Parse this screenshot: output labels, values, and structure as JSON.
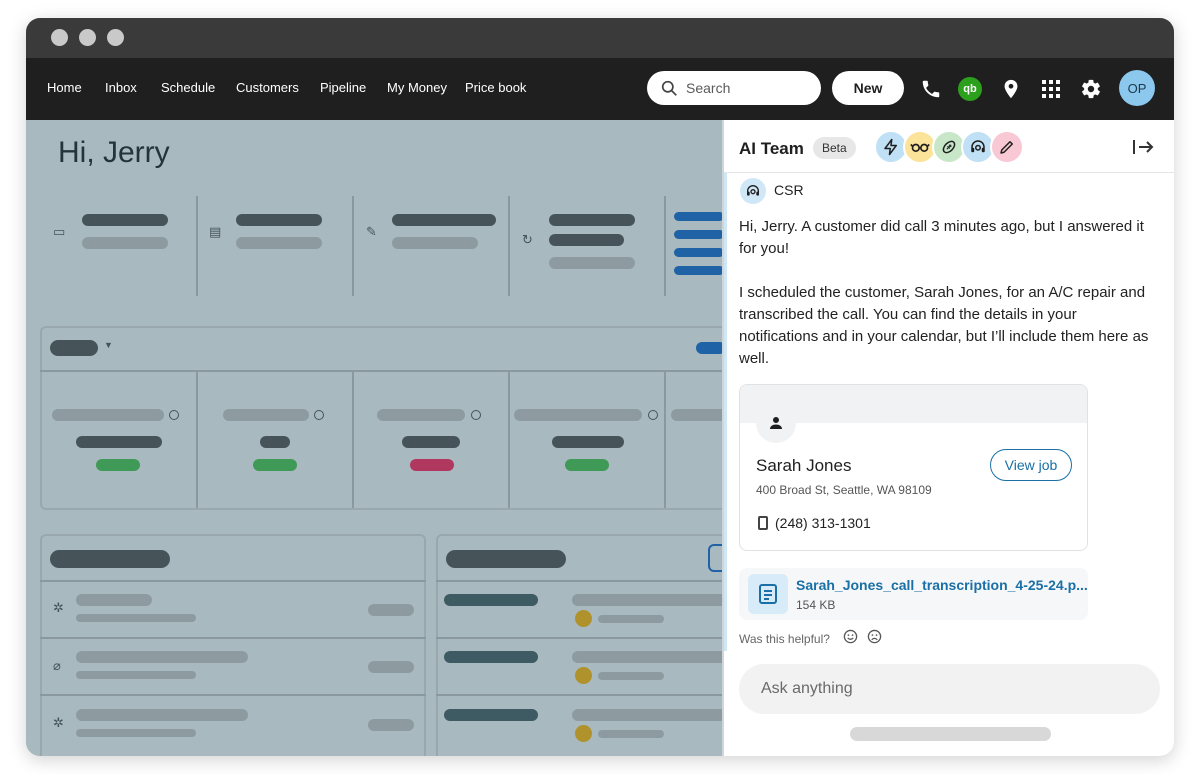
{
  "nav": {
    "links": [
      "Home",
      "Inbox",
      "Schedule",
      "Customers",
      "Pipeline",
      "My Money",
      "Price book"
    ],
    "search_placeholder": "Search",
    "new_label": "New",
    "qb_label": "qb",
    "avatar_initials": "OP",
    "icons": [
      "phone-icon",
      "quickbooks-icon",
      "location-pin-icon",
      "apps-grid-icon",
      "settings-gear-icon"
    ]
  },
  "dashboard": {
    "greeting": "Hi, Jerry"
  },
  "ai_panel": {
    "title": "AI Team",
    "badge": "Beta",
    "agents": [
      "lightning-agent-icon",
      "glasses-agent-icon",
      "football-agent-icon",
      "headset-agent-icon",
      "pencil-agent-icon"
    ],
    "agent_colors": [
      "#bfe0f5",
      "#fbe39a",
      "#c8e7c8",
      "#bfe0f5",
      "#f8c9d4"
    ],
    "sender": "CSR",
    "message_1": "Hi, Jerry. A customer did call 3 minutes ago, but I answered it for you!",
    "message_2": "I scheduled the customer, Sarah Jones, for an A/C repair and transcribed the call. You can find the details in your notifications and in your calendar, but I’ll include them here as well.",
    "customer": {
      "name": "Sarah Jones",
      "address": "400 Broad St, Seattle, WA 98109",
      "phone": "(248) 313-1301",
      "view_job_label": "View job"
    },
    "attachment": {
      "name": "Sarah_Jones_call_transcription_4-25-24.p...",
      "size": "154 KB"
    },
    "helpful_label": "Was this helpful?",
    "input_placeholder": "Ask anything"
  },
  "colors": {
    "nav_bg": "#1f1f1f",
    "accent": "#1a6fa6",
    "overlay": "#a9b9c0"
  }
}
